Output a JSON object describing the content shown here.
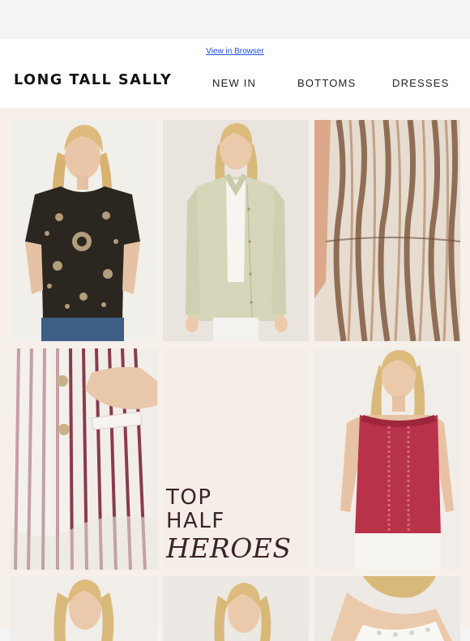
{
  "header": {
    "view_in_browser": "View in Browser",
    "logo": "LONG TALL SALLY",
    "nav": [
      "NEW IN",
      "BOTTOMS",
      "DRESSES"
    ]
  },
  "promo": {
    "line1": "TOP",
    "line2": "HALF",
    "line3": "HEROES"
  },
  "colors": {
    "link": "#1a4fd6",
    "promo_text": "#3a2327",
    "grid_bg": "#f6efea",
    "logo": "#111111"
  }
}
